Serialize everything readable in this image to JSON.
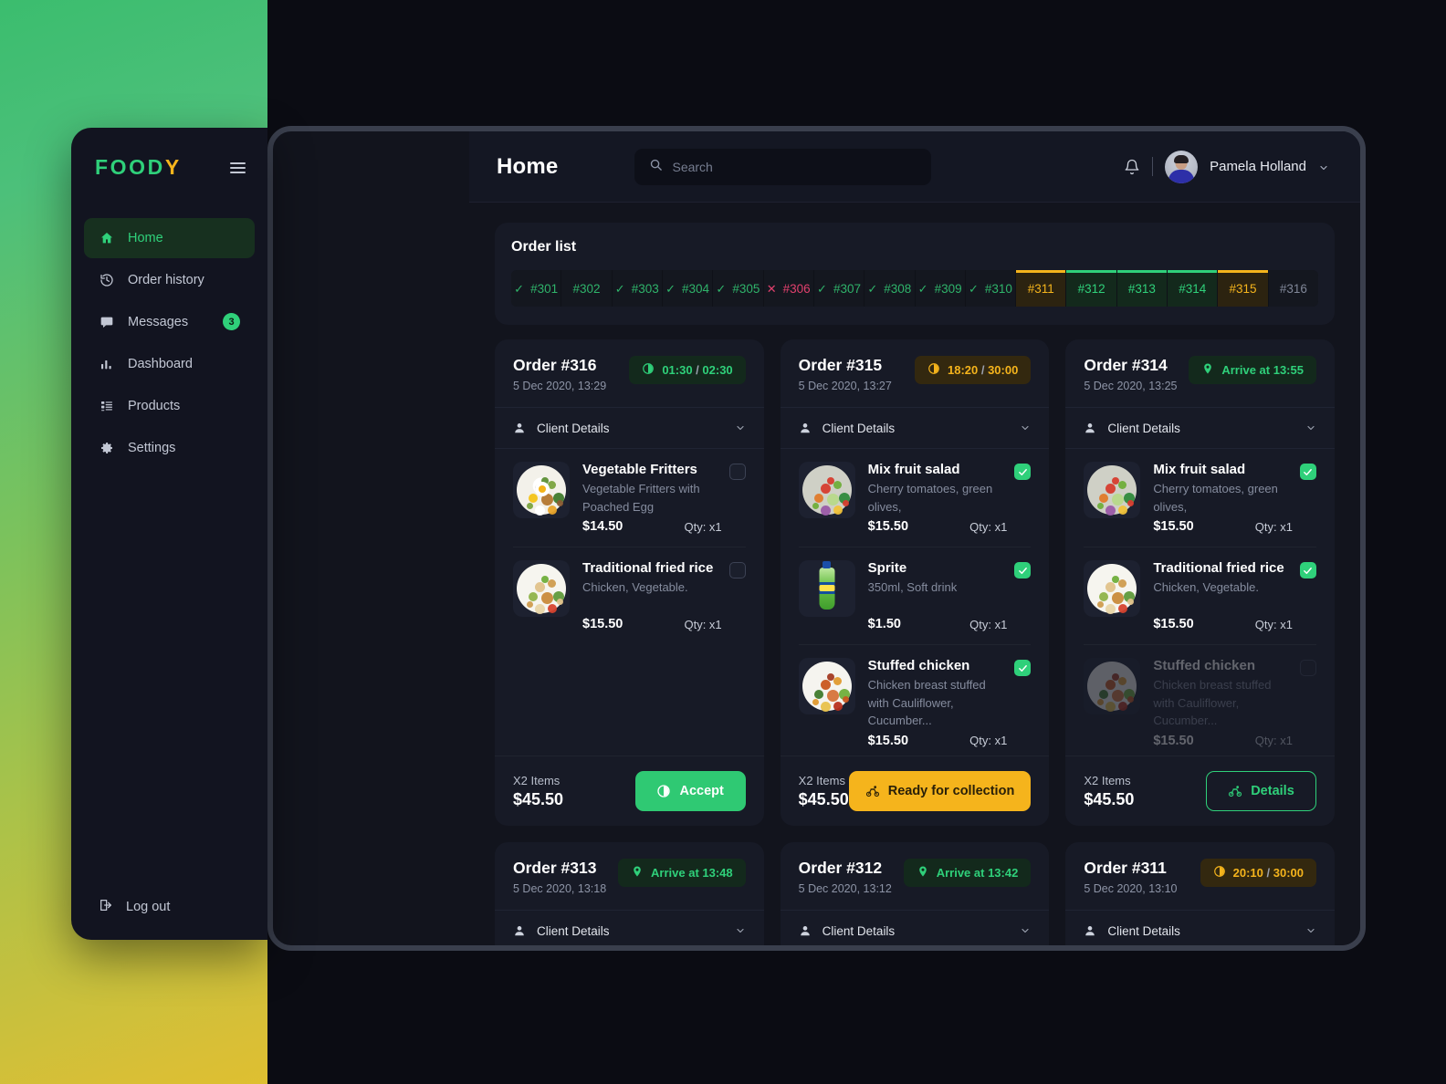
{
  "brand": {
    "name_main": "FOOD",
    "name_accent": "Y"
  },
  "sidebar": {
    "items": [
      {
        "label": "Home",
        "icon": "home-icon",
        "active": true
      },
      {
        "label": "Order history",
        "icon": "history-icon",
        "active": false
      },
      {
        "label": "Messages",
        "icon": "message-icon",
        "active": false,
        "badge": "3"
      },
      {
        "label": "Dashboard",
        "icon": "chart-icon",
        "active": false
      },
      {
        "label": "Products",
        "icon": "list-icon",
        "active": false
      },
      {
        "label": "Settings",
        "icon": "gear-icon",
        "active": false
      }
    ],
    "logout_label": "Log out"
  },
  "header": {
    "title": "Home",
    "search_placeholder": "Search",
    "search_value": "",
    "user_name": "Pamela Holland"
  },
  "order_list": {
    "title": "Order list",
    "tabs": [
      {
        "label": "#301",
        "state": "done",
        "mark": "check"
      },
      {
        "label": "#302",
        "state": "plain",
        "mark": ""
      },
      {
        "label": "#303",
        "state": "done",
        "mark": "check"
      },
      {
        "label": "#304",
        "state": "done",
        "mark": "check"
      },
      {
        "label": "#305",
        "state": "done",
        "mark": "check"
      },
      {
        "label": "#306",
        "state": "cancel",
        "mark": "cross"
      },
      {
        "label": "#307",
        "state": "done",
        "mark": "check"
      },
      {
        "label": "#308",
        "state": "done",
        "mark": "check"
      },
      {
        "label": "#309",
        "state": "done",
        "mark": "check"
      },
      {
        "label": "#310",
        "state": "done",
        "mark": "check"
      },
      {
        "label": "#311",
        "state": "amber-act",
        "mark": ""
      },
      {
        "label": "#312",
        "state": "green-act",
        "mark": ""
      },
      {
        "label": "#313",
        "state": "green-act",
        "mark": ""
      },
      {
        "label": "#314",
        "state": "green-act",
        "mark": ""
      },
      {
        "label": "#315",
        "state": "amber-act",
        "mark": ""
      },
      {
        "label": "#316",
        "state": "pending",
        "mark": ""
      }
    ]
  },
  "client_details_label": "Client Details",
  "cards": [
    {
      "order_no": "Order #316",
      "date": "5 Dec 2020, 13:29",
      "pill": {
        "type": "timer-green",
        "icon": "timer-icon",
        "text": "01:30 / 02:30"
      },
      "items": [
        {
          "name": "Vegetable Fritters",
          "desc": "Vegetable Fritters with Poached Egg",
          "price": "$14.50",
          "qty": "Qty: x1",
          "checked": false,
          "faded": false,
          "art": "veg"
        },
        {
          "name": "Traditional fried rice",
          "desc": "Chicken, Vegetable.",
          "price": "$15.50",
          "qty": "Qty: x1",
          "checked": false,
          "faded": false,
          "art": "rice"
        }
      ],
      "total_label": "X2 Items",
      "total_value": "$45.50",
      "action": {
        "label": "Accept",
        "style": "accept",
        "icon": "timer-icon"
      }
    },
    {
      "order_no": "Order #315",
      "date": "5 Dec 2020, 13:27",
      "pill": {
        "type": "timer-amber",
        "icon": "timer-icon",
        "text": "18:20 / 30:00"
      },
      "items": [
        {
          "name": "Mix fruit salad",
          "desc": "Cherry tomatoes, green olives,",
          "price": "$15.50",
          "qty": "Qty: x1",
          "checked": true,
          "faded": false,
          "art": "salad"
        },
        {
          "name": "Sprite",
          "desc": "350ml, Soft drink",
          "price": "$1.50",
          "qty": "Qty: x1",
          "checked": true,
          "faded": false,
          "art": "sprite"
        },
        {
          "name": "Stuffed chicken",
          "desc": "Chicken breast stuffed with Cauliflower, Cucumber...",
          "price": "$15.50",
          "qty": "Qty: x1",
          "checked": true,
          "faded": false,
          "art": "chick"
        }
      ],
      "total_label": "X2 Items",
      "total_value": "$45.50",
      "action": {
        "label": "Ready for collection",
        "style": "ready",
        "icon": "bike-icon"
      }
    },
    {
      "order_no": "Order #314",
      "date": "5 Dec 2020, 13:25",
      "pill": {
        "type": "location",
        "icon": "pin-icon",
        "text": "Arrive at 13:55"
      },
      "items": [
        {
          "name": "Mix fruit salad",
          "desc": "Cherry tomatoes, green olives,",
          "price": "$15.50",
          "qty": "Qty: x1",
          "checked": true,
          "faded": false,
          "art": "salad"
        },
        {
          "name": "Traditional fried rice",
          "desc": "Chicken, Vegetable.",
          "price": "$15.50",
          "qty": "Qty: x1",
          "checked": true,
          "faded": false,
          "art": "rice"
        },
        {
          "name": "Stuffed chicken",
          "desc": "Chicken breast stuffed with Cauliflower, Cucumber...",
          "price": "$15.50",
          "qty": "Qty: x1",
          "checked": false,
          "faded": true,
          "art": "chick"
        }
      ],
      "total_label": "X2 Items",
      "total_value": "$45.50",
      "action": {
        "label": "Details",
        "style": "details",
        "icon": "bike-icon"
      }
    }
  ],
  "cards_row2": [
    {
      "order_no": "Order #313",
      "date": "5 Dec 2020, 13:18",
      "pill": {
        "type": "location",
        "icon": "pin-icon",
        "text": "Arrive at 13:48"
      }
    },
    {
      "order_no": "Order #312",
      "date": "5 Dec 2020, 13:12",
      "pill": {
        "type": "location",
        "icon": "pin-icon",
        "text": "Arrive at 13:42"
      }
    },
    {
      "order_no": "Order #311",
      "date": "5 Dec 2020, 13:10",
      "pill": {
        "type": "timer-amber",
        "icon": "timer-icon",
        "text": "20:10 / 30:00"
      }
    }
  ],
  "colors": {
    "green": "#2fd07a",
    "amber": "#f5b41c",
    "red": "#e0406d",
    "card_bg": "#171a26",
    "app_bg": "#12141d"
  }
}
